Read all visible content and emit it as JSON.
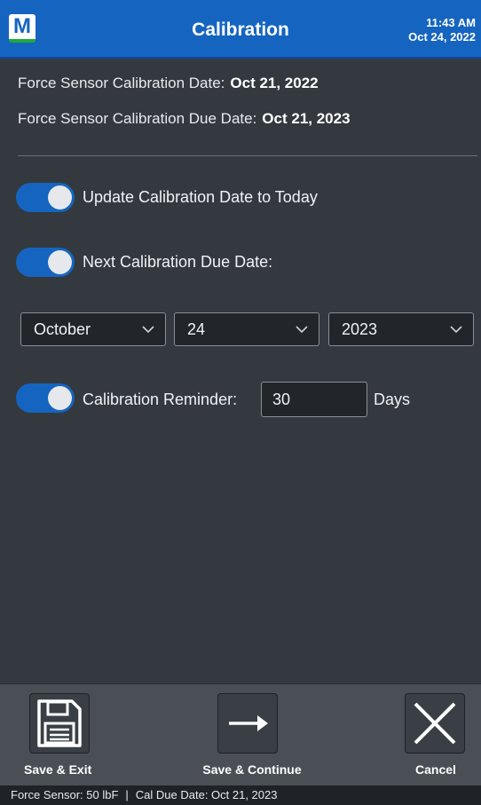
{
  "header": {
    "logo_letter": "M",
    "title": "Calibration",
    "time": "11:43 AM",
    "date": "Oct 24, 2022",
    "bg_color": "#1565c0"
  },
  "info": {
    "cal_date_label": "Force Sensor Calibration Date:",
    "cal_date_value": "Oct 21, 2022",
    "due_date_label": "Force Sensor Calibration Due Date:",
    "due_date_value": "Oct 21, 2023"
  },
  "options": {
    "update_today": {
      "label": "Update Calibration Date to Today",
      "on": true
    },
    "next_due": {
      "label": "Next Calibration Due Date:",
      "on": true
    },
    "reminder": {
      "label": "Calibration Reminder:",
      "on": true,
      "value": "30",
      "unit": "Days"
    }
  },
  "due_date_select": {
    "month": "October",
    "day": "24",
    "year": "2023"
  },
  "toolbar": {
    "save_exit": "Save & Exit",
    "save_continue": "Save & Continue",
    "cancel": "Cancel",
    "icons": [
      "floppy-disk-icon",
      "arrow-right-icon",
      "close-x-icon"
    ]
  },
  "status": {
    "sensor": "Force Sensor: 50 lbF",
    "separator": "|",
    "cal_due": "Cal Due Date: Oct 21, 2023"
  }
}
